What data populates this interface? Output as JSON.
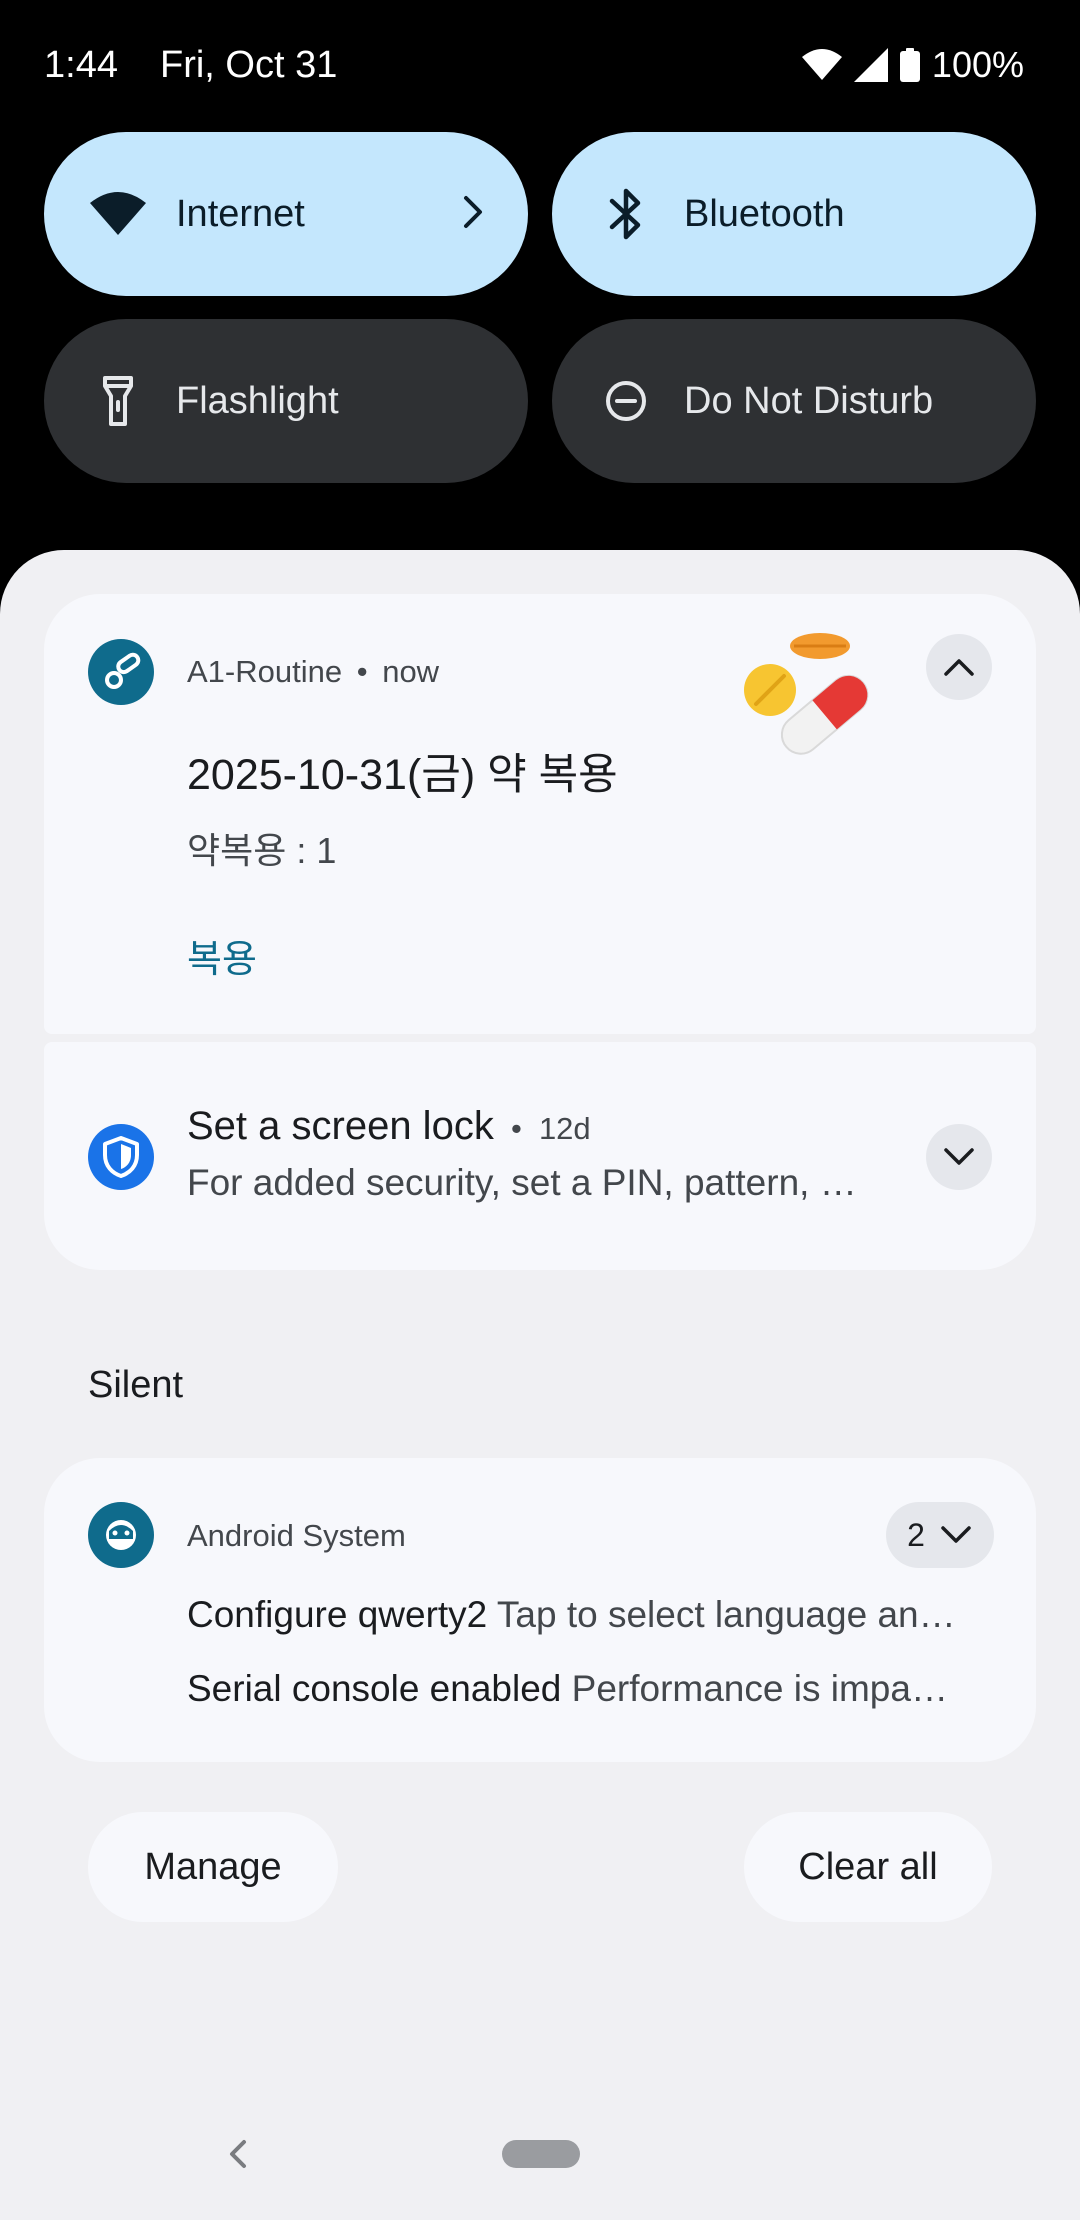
{
  "status_bar": {
    "time": "1:44",
    "date": "Fri, Oct 31",
    "battery": "100%"
  },
  "quick_settings": {
    "tiles": [
      {
        "label": "Internet",
        "state": "on",
        "icon": "wifi-icon"
      },
      {
        "label": "Bluetooth",
        "state": "on",
        "icon": "bluetooth-icon"
      },
      {
        "label": "Flashlight",
        "state": "off",
        "icon": "flashlight-icon"
      },
      {
        "label": "Do Not Disturb",
        "state": "off",
        "icon": "do-not-disturb-icon"
      }
    ]
  },
  "notifications": {
    "a1": {
      "app": "A1-Routine",
      "time": "now",
      "separator": "•",
      "title": "2025-10-31(금) 약 복용",
      "text": "약복용 : 1",
      "action": "복용",
      "icon": "pills-icon",
      "accent": "#0f6b8c"
    },
    "screen_lock": {
      "title": "Set a screen lock",
      "time": "12d",
      "separator": "•",
      "text": "For added security, set a PIN, pattern, …",
      "icon": "shield-icon",
      "accent": "#1a73e8"
    },
    "silent_label": "Silent",
    "android_system": {
      "app": "Android System",
      "count": "2",
      "rows": [
        {
          "title": "Configure qwerty2",
          "text": "Tap to select language an…"
        },
        {
          "title": "Serial console enabled",
          "text": "Performance is impa…"
        }
      ],
      "icon": "android-icon"
    }
  },
  "buttons": {
    "manage": "Manage",
    "clear_all": "Clear all"
  },
  "colors": {
    "tile_on": "#c4e7fd",
    "tile_off": "#2e3033",
    "shade": "#f0f0f3",
    "card": "#f7f8fc"
  }
}
